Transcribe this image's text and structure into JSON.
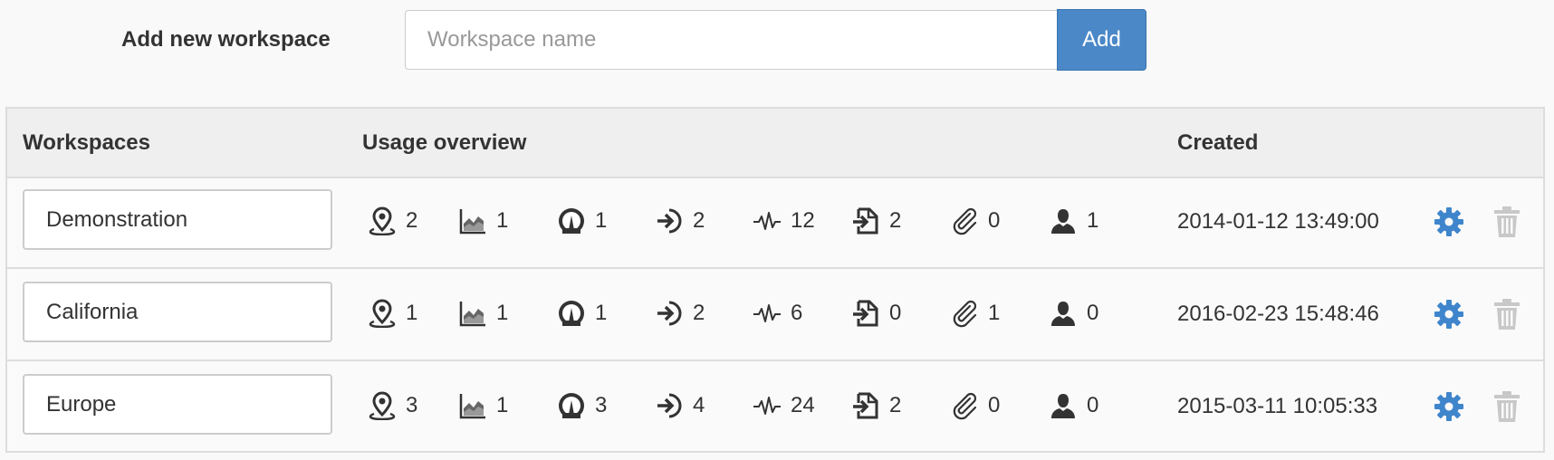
{
  "add_workspace": {
    "label": "Add new workspace",
    "placeholder": "Workspace name",
    "button_label": "Add"
  },
  "table": {
    "headers": {
      "workspaces": "Workspaces",
      "usage": "Usage overview",
      "created": "Created"
    },
    "usage_icons": [
      "map-pin-icon",
      "area-chart-icon",
      "gauge-icon",
      "sign-in-icon",
      "pulse-icon",
      "file-import-icon",
      "paperclip-icon",
      "user-icon"
    ],
    "rows": [
      {
        "name": "Demonstration",
        "counts": [
          "2",
          "1",
          "1",
          "2",
          "12",
          "2",
          "0",
          "1"
        ],
        "created": "2014-01-12 13:49:00"
      },
      {
        "name": "California",
        "counts": [
          "1",
          "1",
          "1",
          "2",
          "6",
          "0",
          "1",
          "0"
        ],
        "created": "2016-02-23 15:48:46"
      },
      {
        "name": "Europe",
        "counts": [
          "3",
          "1",
          "3",
          "4",
          "24",
          "2",
          "0",
          "0"
        ],
        "created": "2015-03-11 10:05:33"
      }
    ]
  },
  "colors": {
    "primary": "#4a88c8",
    "gear": "#3f85cc",
    "trash": "#c8c8c8"
  }
}
